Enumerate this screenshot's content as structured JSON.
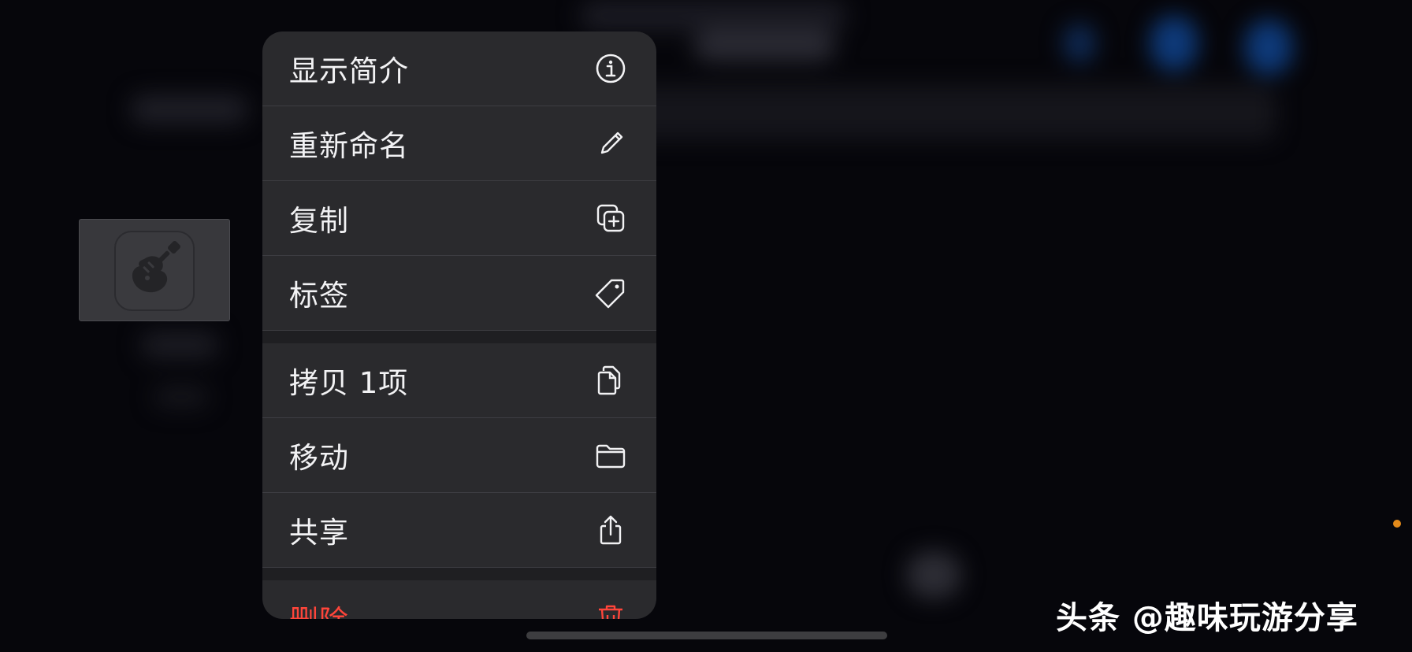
{
  "menu": {
    "group1": [
      {
        "label": "显示简介",
        "icon": "info-circle-icon"
      },
      {
        "label": "重新命名",
        "icon": "pencil-icon"
      },
      {
        "label": "复制",
        "icon": "duplicate-plus-icon"
      },
      {
        "label": "标签",
        "icon": "tag-icon"
      }
    ],
    "group2": [
      {
        "label": "拷贝 1项",
        "icon": "copy-documents-icon"
      },
      {
        "label": "移动",
        "icon": "folder-icon"
      },
      {
        "label": "共享",
        "icon": "share-icon"
      }
    ],
    "group3": [
      {
        "label": "删除",
        "icon": "trash-icon"
      }
    ]
  },
  "thumbnail": {
    "icon": "guitar-app-icon"
  },
  "watermark": "头条 @趣味玩游分享",
  "colors": {
    "menu_bg": "#2a2a2d",
    "danger": "#ff453a",
    "text": "#f2f2f4",
    "status_dot": "#e38a1a"
  }
}
